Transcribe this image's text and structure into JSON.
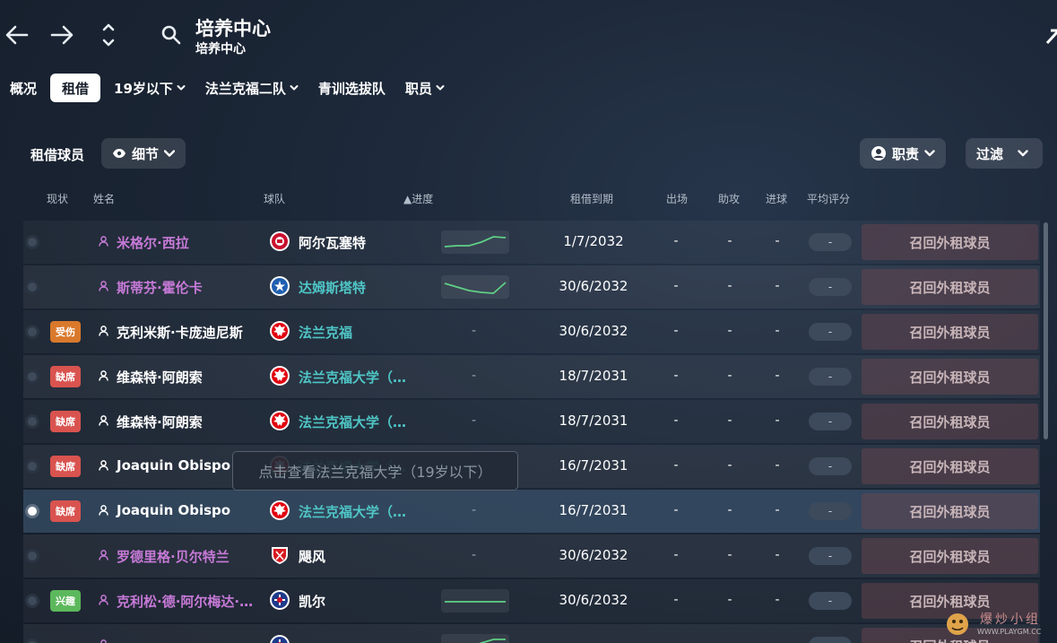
{
  "header": {
    "title": "培养中心",
    "subtitle": "培养中心"
  },
  "tabs": [
    {
      "label": "概况",
      "active": false,
      "dropdown": false
    },
    {
      "label": "租借",
      "active": true,
      "dropdown": false
    },
    {
      "label": "19岁以下",
      "active": false,
      "dropdown": true
    },
    {
      "label": "法兰克福二队",
      "active": false,
      "dropdown": true
    },
    {
      "label": "青训选拔队",
      "active": false,
      "dropdown": false
    },
    {
      "label": "职员",
      "active": false,
      "dropdown": true
    }
  ],
  "section": {
    "title": "租借球员",
    "view_label": "细节",
    "role_label": "职责",
    "filter_label": "过滤"
  },
  "columns": {
    "status": "现状",
    "name": "姓名",
    "club": "球队",
    "progress": "▲进度",
    "loan_end": "租借到期",
    "apps": "出场",
    "assists": "助攻",
    "goals": "进球",
    "avg_rating": "平均评分"
  },
  "recall_label": "召回外租球员",
  "rating_placeholder": "-",
  "trend_placeholder": "-",
  "stat_placeholder": "-",
  "tooltip": "点击查看法兰克福大学（19岁以下）",
  "watermark": {
    "text": "爆炒小组",
    "url": "WWW.PLAYGM.CC"
  },
  "colors": {
    "purple_name": "#c77ad8",
    "teal_club": "#4fc6c6",
    "white": "#ffffff",
    "recall_bg": "#6e4650",
    "trend_line": "#5fcf86"
  },
  "players": [
    {
      "name": "米格尔·西拉",
      "name_color": "purple",
      "club": "阿尔瓦塞特",
      "club_color": "white",
      "crest": "albacete",
      "badge": "",
      "trend": [
        0.3,
        0.35,
        0.35,
        0.55,
        0.85,
        0.8
      ],
      "loan_end": "1/7/2032"
    },
    {
      "name": "斯蒂芬·霍伦卡",
      "name_color": "purple",
      "club": "达姆斯塔特",
      "club_color": "teal",
      "crest": "darmstadt",
      "badge": "",
      "trend": [
        0.75,
        0.55,
        0.35,
        0.25,
        0.2,
        0.8
      ],
      "loan_end": "30/6/2032"
    },
    {
      "name": "克利米斯·卡庞迪尼斯",
      "name_color": "white",
      "club": "法兰克福",
      "club_color": "teal",
      "crest": "eagle",
      "badge": "受伤",
      "badge_type": "injury",
      "trend": null,
      "loan_end": "30/6/2032"
    },
    {
      "name": "维森特·阿朗索",
      "name_color": "white",
      "club": "法兰克福大学（…",
      "club_color": "teal",
      "crest": "eagle",
      "badge": "缺席",
      "badge_type": "absent",
      "trend": null,
      "loan_end": "18/7/2031"
    },
    {
      "name": "维森特·阿朗索",
      "name_color": "white",
      "club": "法兰克福大学（…",
      "club_color": "teal",
      "crest": "eagle",
      "badge": "缺席",
      "badge_type": "absent",
      "trend": null,
      "loan_end": "18/7/2031"
    },
    {
      "name": "Joaquin Obispo",
      "name_color": "white",
      "club": "法兰克福大学（…",
      "club_color": "teal",
      "crest": "eagle",
      "badge": "缺席",
      "badge_type": "absent",
      "trend": null,
      "loan_end": "16/7/2031"
    },
    {
      "name": "Joaquin Obispo",
      "name_color": "white",
      "club": "法兰克福大学（…",
      "club_color": "teal",
      "crest": "eagle",
      "badge": "缺席",
      "badge_type": "absent",
      "trend": null,
      "loan_end": "16/7/2031",
      "selected": true
    },
    {
      "name": "罗德里格·贝尔特兰",
      "name_color": "purple",
      "club": "飓风",
      "club_color": "white",
      "crest": "huracan",
      "badge": "",
      "trend": null,
      "loan_end": "30/6/2032"
    },
    {
      "name": "克利松·德·阿尔梅达·…",
      "name_color": "purple",
      "club": "凯尔",
      "club_color": "white",
      "crest": "kiel",
      "badge": "兴趣",
      "badge_type": "interest",
      "trend": [
        0.5,
        0.5,
        0.5,
        0.5,
        0.5,
        0.5
      ],
      "loan_end": "30/6/2032"
    },
    {
      "name": "",
      "name_color": "purple",
      "club": "",
      "club_color": "white",
      "crest": "kiel",
      "badge": "",
      "trend": [
        0.1,
        0.2,
        0.4,
        0.7,
        0.9,
        0.9
      ],
      "loan_end": ""
    }
  ]
}
